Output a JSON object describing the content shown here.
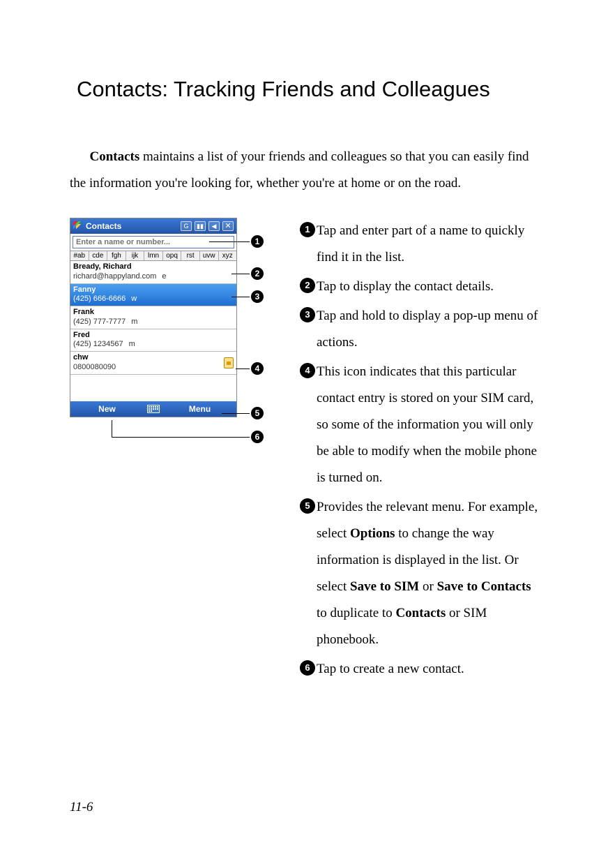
{
  "page_title": "Contacts: Tracking Friends and Colleagues",
  "intro_lead_bold": "Contacts",
  "intro_rest": " maintains a list of your friends and colleagues so that you can easily find the information you're looking for, whether you're at home or on the road.",
  "device": {
    "titlebar": {
      "app_name": "Contacts",
      "g_label": "G",
      "signal_glyph": "▮▮",
      "speaker_glyph": "◀",
      "close_glyph": "✕"
    },
    "search_placeholder": "Enter a name or number...",
    "alphabar": [
      "#ab",
      "cde",
      "fgh",
      "ijk",
      "lmn",
      "opq",
      "rst",
      "uvw",
      "xyz"
    ],
    "contacts": [
      {
        "name": "Bready, Richard",
        "detail": "richard@happyland.com",
        "tag": "e",
        "selected": false,
        "sim": false
      },
      {
        "name": "Fanny",
        "detail": "(425) 666-6666",
        "tag": "w",
        "selected": true,
        "sim": false
      },
      {
        "name": "Frank",
        "detail": "(425) 777-7777",
        "tag": "m",
        "selected": false,
        "sim": false
      },
      {
        "name": "Fred",
        "detail": "(425) 1234567",
        "tag": "m",
        "selected": false,
        "sim": false
      },
      {
        "name": "chw",
        "detail": "0800080090",
        "tag": "",
        "selected": false,
        "sim": true
      }
    ],
    "bottombar": {
      "new_label": "New",
      "menu_label": "Menu"
    }
  },
  "callouts": {
    "n1": "❶",
    "n2": "❷",
    "n3": "❸",
    "n4": "❹",
    "n5": "❺",
    "n6": "❻"
  },
  "descriptions": [
    {
      "n": "1",
      "html": "Tap and enter part of a name to quickly find it in the list."
    },
    {
      "n": "2",
      "html": "Tap to display the contact details."
    },
    {
      "n": "3",
      "html": "Tap and hold to display a pop-up menu of actions."
    },
    {
      "n": "4",
      "html": "This icon indicates that this particular contact entry is stored on your SIM card, so some of the information you will only be able to modify when the mobile phone is turned on."
    },
    {
      "n": "5",
      "html": "Provides the relevant menu. For example, select <b>Options</b> to change the way information is displayed in the list. Or select <b>Save to SIM</b> or <b>Save to Contacts</b> to duplicate to <b>Contacts</b> or SIM phonebook."
    },
    {
      "n": "6",
      "html": "Tap to create a new contact."
    }
  ],
  "page_number": "11-6"
}
